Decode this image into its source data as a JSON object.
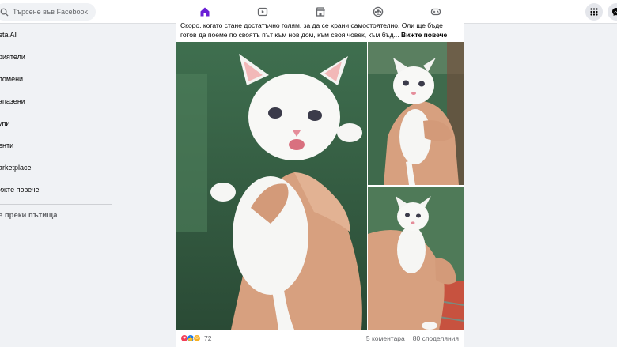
{
  "search": {
    "placeholder": "Търсене във Facebook"
  },
  "nav": {
    "tabs": [
      {
        "name": "home",
        "icon": "home-icon",
        "active": true
      },
      {
        "name": "video",
        "icon": "video-icon",
        "active": false
      },
      {
        "name": "marketplace",
        "icon": "marketplace-icon",
        "active": false
      },
      {
        "name": "groups",
        "icon": "groups-icon",
        "active": false
      },
      {
        "name": "gaming",
        "icon": "gaming-icon",
        "active": false
      }
    ],
    "accent": "#6a1fd6"
  },
  "sidebar": {
    "items": [
      {
        "label": "eta AI"
      },
      {
        "label": "риятели"
      },
      {
        "label": "помени"
      },
      {
        "label": "апазени"
      },
      {
        "label": "упи"
      },
      {
        "label": "енти"
      },
      {
        "label": "arketplace"
      },
      {
        "label": "ижте повече"
      }
    ],
    "shortcuts_heading": "е преки пътища"
  },
  "post": {
    "text": "Скоро, когато стане достатъчно голям, за да се храни самостоятелно, Оли ще бъде готов да поеме по своятъ път към нов дом, към своя човек, към бъд...",
    "see_more": "Вижте повече",
    "reaction_count": "72",
    "comments": "5 коментара",
    "shares": "80 споделяния"
  },
  "colors": {
    "like": "#1877f2",
    "love": "#f33e58",
    "care": "#f7b125"
  }
}
